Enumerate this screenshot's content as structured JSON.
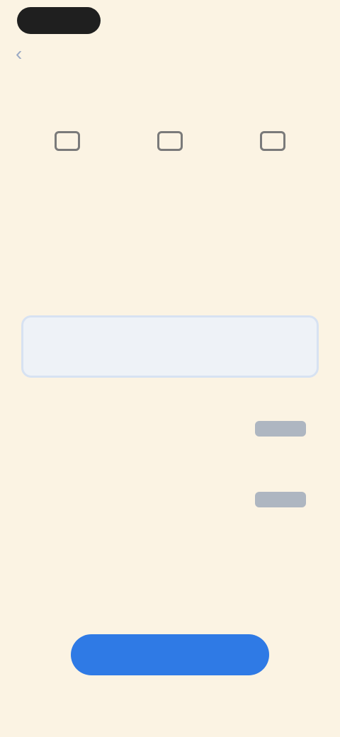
{
  "status_bar": {
    "right_text": ""
  },
  "header": {
    "label": ""
  },
  "headline": "",
  "features": [
    {
      "line1": "",
      "line2": ""
    },
    {
      "line1": "",
      "line2": ""
    },
    {
      "line1": "",
      "line2": ""
    }
  ],
  "compare_link": "",
  "section": {
    "title": "",
    "subtitle": ""
  },
  "plans": [
    {
      "name": "",
      "description": "",
      "price": "",
      "badge": ""
    },
    {
      "name": "",
      "description": "",
      "price": "",
      "badge": ""
    },
    {
      "name": "",
      "description": "",
      "price": "",
      "badge": ""
    }
  ],
  "footer": {
    "left_link": "",
    "right_link": ""
  },
  "note": "",
  "cta": {
    "label": "",
    "sublabel": ""
  },
  "colors": {
    "background": "#fbf3e3",
    "accent": "#2f7ae5",
    "selected_border": "#d7e2f2"
  }
}
